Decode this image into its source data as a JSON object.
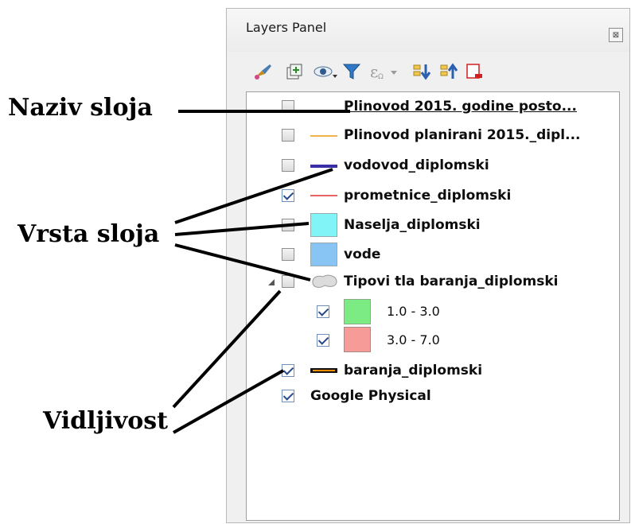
{
  "panel": {
    "title": "Layers Panel",
    "close_label": "⊠",
    "toolbar": [
      {
        "name": "paint-brush-icon",
        "label": "style-manager"
      },
      {
        "name": "add-group-icon",
        "label": "add-group"
      },
      {
        "name": "eye-icon",
        "label": "visibility"
      },
      {
        "name": "filter-icon",
        "label": "filter"
      },
      {
        "name": "expression-filter-icon",
        "label": "expression"
      },
      {
        "name": "expand-all-icon",
        "label": "expand-all"
      },
      {
        "name": "collapse-all-icon",
        "label": "collapse-all"
      },
      {
        "name": "remove-layer-icon",
        "label": "remove-layer"
      }
    ]
  },
  "layers": [
    {
      "label": "Plinovod 2015. godine posto...",
      "checked": false,
      "symbol": "none",
      "underline": true
    },
    {
      "label": "Plinovod planirani 2015._dipl...",
      "checked": false,
      "symbol": "line",
      "color": "#f2b24a"
    },
    {
      "label": "vodovod_diplomski",
      "checked": false,
      "symbol": "line-thick",
      "color": "#3a2fa6"
    },
    {
      "label": "prometnice_diplomski",
      "checked": true,
      "symbol": "line",
      "color": "#e03030"
    },
    {
      "label": "Naselja_diplomski",
      "checked": false,
      "symbol": "fill",
      "color": "#80f4f7"
    },
    {
      "label": "vode",
      "checked": false,
      "symbol": "fill",
      "color": "#88c4f4"
    },
    {
      "label": "Tipovi tla baranja_diplomski",
      "checked": false,
      "symbol": "shape",
      "expanded": true
    },
    {
      "label": "1.0 - 3.0",
      "checked": true,
      "symbol": "fill",
      "color": "#7deb84",
      "child": true
    },
    {
      "label": "3.0 - 7.0",
      "checked": true,
      "symbol": "fill",
      "color": "#f79b98",
      "child": true
    },
    {
      "label": "baranja_diplomski",
      "checked": true,
      "symbol": "line-outline",
      "color": "#ff8c00"
    },
    {
      "label": "Google Physical",
      "checked": true,
      "symbol": "none"
    }
  ],
  "annotations": {
    "layer_name": "Naziv sloja",
    "layer_type": "Vrsta sloja",
    "visibility": "Vidljivost"
  }
}
